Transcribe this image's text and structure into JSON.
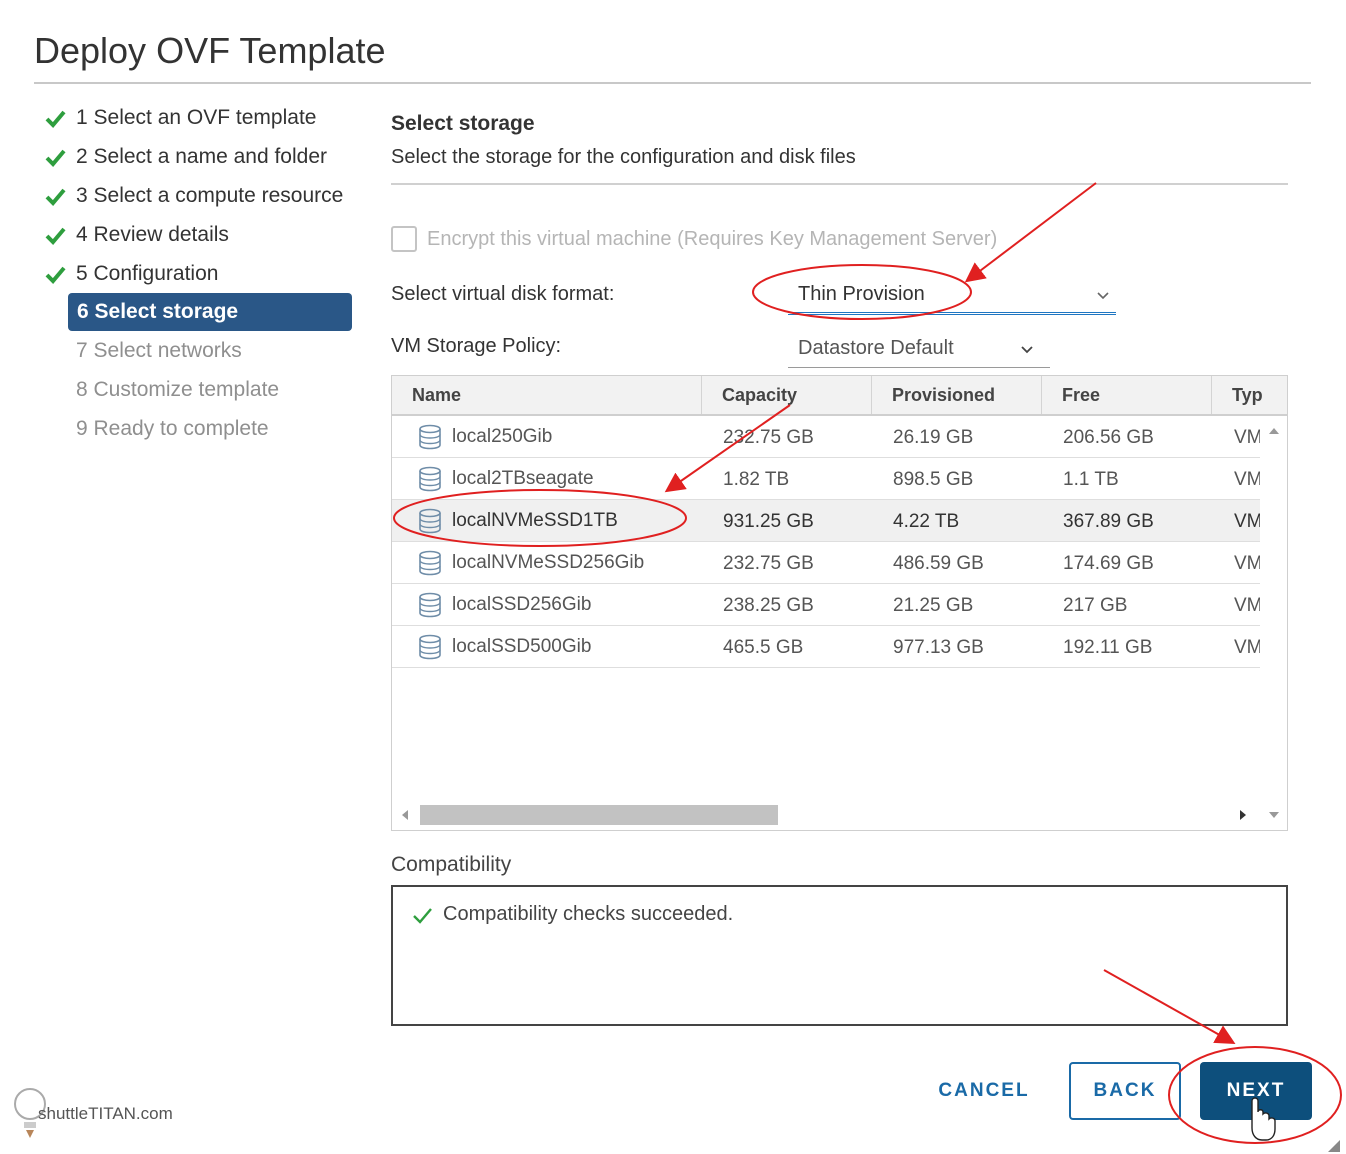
{
  "dialog": {
    "title": "Deploy OVF Template"
  },
  "steps": [
    {
      "label": "1 Select an OVF template",
      "state": "done"
    },
    {
      "label": "2 Select a name and folder",
      "state": "done"
    },
    {
      "label": "3 Select a compute resource",
      "state": "done"
    },
    {
      "label": "4 Review details",
      "state": "done"
    },
    {
      "label": "5 Configuration",
      "state": "done"
    },
    {
      "label": "6 Select storage",
      "state": "active"
    },
    {
      "label": "7 Select networks",
      "state": "pending"
    },
    {
      "label": "8 Customize template",
      "state": "pending"
    },
    {
      "label": "9 Ready to complete",
      "state": "pending"
    }
  ],
  "section": {
    "title": "Select storage",
    "description": "Select the storage for the configuration and disk files"
  },
  "encrypt": {
    "label": "Encrypt this virtual machine (Requires Key Management Server)",
    "checked": false
  },
  "disk_format": {
    "label": "Select virtual disk format:",
    "value": "Thin Provision"
  },
  "storage_policy": {
    "label": "VM Storage Policy:",
    "value": "Datastore Default"
  },
  "table": {
    "columns": [
      "Name",
      "Capacity",
      "Provisioned",
      "Free",
      "Typ"
    ],
    "rows": [
      {
        "name": "local250Gib",
        "capacity": "232.75 GB",
        "provisioned": "26.19 GB",
        "free": "206.56 GB",
        "type": "VM"
      },
      {
        "name": "local2TBseagate",
        "capacity": "1.82 TB",
        "provisioned": "898.5 GB",
        "free": "1.1 TB",
        "type": "VM"
      },
      {
        "name": "localNVMeSSD1TB",
        "capacity": "931.25 GB",
        "provisioned": "4.22 TB",
        "free": "367.89 GB",
        "type": "VM"
      },
      {
        "name": "localNVMeSSD256Gib",
        "capacity": "232.75 GB",
        "provisioned": "486.59 GB",
        "free": "174.69 GB",
        "type": "VM"
      },
      {
        "name": "localSSD256Gib",
        "capacity": "238.25 GB",
        "provisioned": "21.25 GB",
        "free": "217 GB",
        "type": "VM"
      },
      {
        "name": "localSSD500Gib",
        "capacity": "465.5 GB",
        "provisioned": "977.13 GB",
        "free": "192.11 GB",
        "type": "VM"
      }
    ],
    "selected_row": "localNVMeSSD1TB"
  },
  "compatibility": {
    "label": "Compatibility",
    "message": "Compatibility checks succeeded."
  },
  "buttons": {
    "cancel": "CANCEL",
    "back": "BACK",
    "next": "NEXT"
  },
  "watermark": "shuttleTITAN.com",
  "colors": {
    "accent": "#2a5787",
    "primary_button": "#0d4f7c",
    "link": "#1a6aa7",
    "check": "#2e9e3e",
    "annotation": "#e02020"
  },
  "icons": {
    "step_done": "check-icon",
    "datastore": "database-icon",
    "dropdown": "chevron-down-icon"
  }
}
